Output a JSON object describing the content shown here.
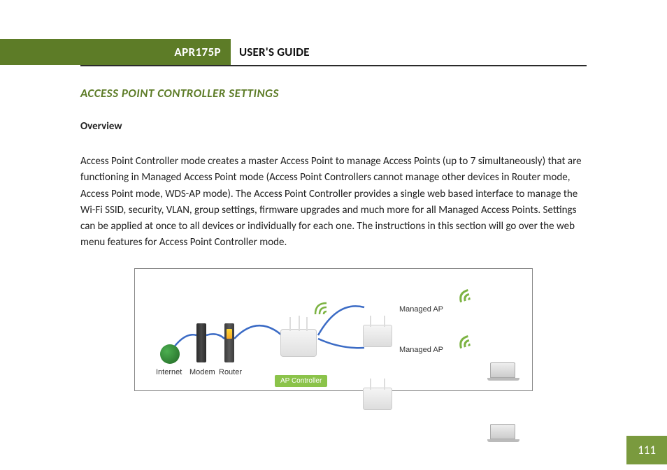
{
  "header": {
    "model": "APR175P",
    "guide_title": "USER'S GUIDE"
  },
  "section": {
    "title": "ACCESS POINT CONTROLLER SETTINGS",
    "subheading": "Overview",
    "body": "Access Point Controller mode creates a master Access Point to manage Access Points (up to 7 simultaneously) that are functioning in Managed Access Point mode (Access Point Controllers cannot manage other devices in Router mode, Access Point mode, WDS-AP mode).  The Access Point Controller provides a single web based interface to manage the Wi-Fi SSID, security, VLAN, group settings, firmware upgrades and much more for all Managed Access Points.  Settings can be applied at once to all devices or individually for each one.  The instructions in this section will go over the web menu features for Access Point Controller mode."
  },
  "diagram": {
    "labels": {
      "internet": "Internet",
      "modem": "Modem",
      "router": "Router",
      "ap_controller": "AP Controller",
      "managed_ap_1": "Managed AP",
      "managed_ap_2": "Managed AP"
    }
  },
  "page_number": "111"
}
